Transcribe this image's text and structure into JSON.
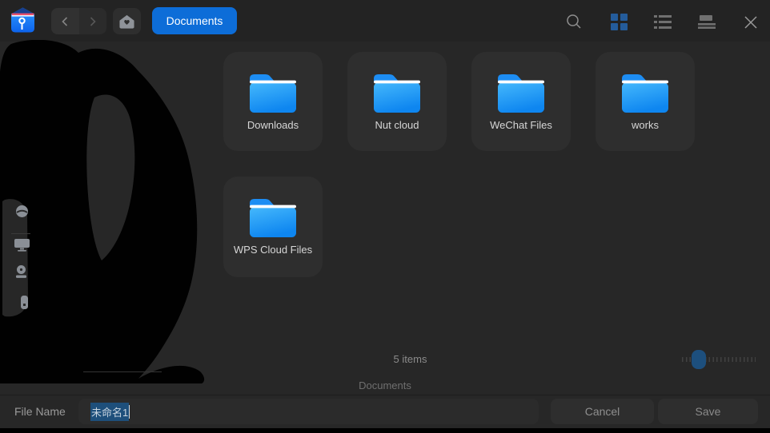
{
  "colors": {
    "accent_blue": "#0d6dd8",
    "active_view_blue": "#245c9b",
    "slider_thumb_blue": "#1d4f7d",
    "selection_blue": "#1e4f7b",
    "folder_blue_top": "#45b8fc",
    "folder_blue_bottom": "#0e86f0",
    "window_bg": "#272727",
    "tile_bg": "#2e2e2e"
  },
  "topbar": {
    "app_icon": "file-manager-app-icon",
    "back_icon": "chevron-left-icon",
    "forward_icon": "chevron-right-icon",
    "home_icon": "home-icon",
    "breadcrumb_label": "Documents",
    "search_icon": "search-icon",
    "grid_view_icon": "grid-view-icon",
    "list_view_icon": "list-view-icon",
    "detail_view_icon": "detail-view-icon",
    "close_icon": "close-icon"
  },
  "sidebar": {
    "icons": [
      "disc-icon",
      "computer-icon",
      "disk-icon",
      "drive-icon"
    ],
    "note_overlay": "black-scribble-redaction"
  },
  "main": {
    "folders": [
      {
        "name": "Downloads"
      },
      {
        "name": "Nut cloud"
      },
      {
        "name": "WeChat Files"
      },
      {
        "name": "works"
      },
      {
        "name": "WPS Cloud Files"
      }
    ]
  },
  "statusbar": {
    "items_count": "5 items"
  },
  "path_label": "Documents",
  "footer": {
    "file_name_label": "File Name",
    "file_name_value": "未命名1",
    "cancel_label": "Cancel",
    "save_label": "Save"
  }
}
